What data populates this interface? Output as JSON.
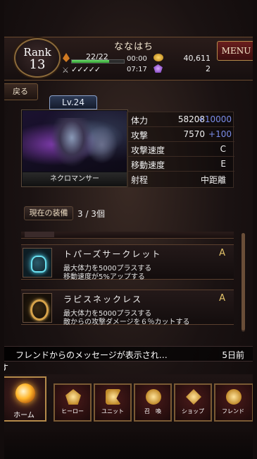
{
  "player": {
    "name": "ななはち",
    "rank_label": "Rank",
    "rank_value": "13",
    "stamina": "22/22",
    "exp_percent": 72,
    "tickets": "✓✓✓✓✓",
    "timer1": "00:00",
    "timer2": "07:17",
    "coins": "40,611",
    "gems": "2"
  },
  "header": {
    "menu_label": "MENU",
    "back_label": "戻る"
  },
  "hero": {
    "level": "Lv.24",
    "name": "ネクロマンサー",
    "stats": [
      {
        "label": "体力",
        "value": "58208",
        "bonus": "+10000"
      },
      {
        "label": "攻撃",
        "value": "7570",
        "bonus": "+100"
      },
      {
        "label": "攻撃速度",
        "value": "C"
      },
      {
        "label": "移動速度",
        "value": "E"
      },
      {
        "label": "射程",
        "value": "中距離"
      }
    ]
  },
  "equipment": {
    "header": "現在の装備",
    "count": "3 / 3個",
    "items": [
      {
        "name": "トパーズサークレット",
        "grade": "A",
        "desc1": "最大体力を5000プラスする",
        "desc2": "移動速度が5%アップする"
      },
      {
        "name": "ラピスネックレス",
        "grade": "A",
        "desc1": "最大体力を5000プラスする",
        "desc2": "敵からの攻撃ダメージを６％カットする"
      }
    ]
  },
  "message": {
    "text": "フレンドからのメッセージが表示され…",
    "time": "5日前",
    "ticker_char": "す"
  },
  "nav": {
    "home": "ホーム",
    "hero": "ヒーロー",
    "unit": "ユニット",
    "summon": "召　喚",
    "shop": "ショップ",
    "friend": "フレンド"
  }
}
